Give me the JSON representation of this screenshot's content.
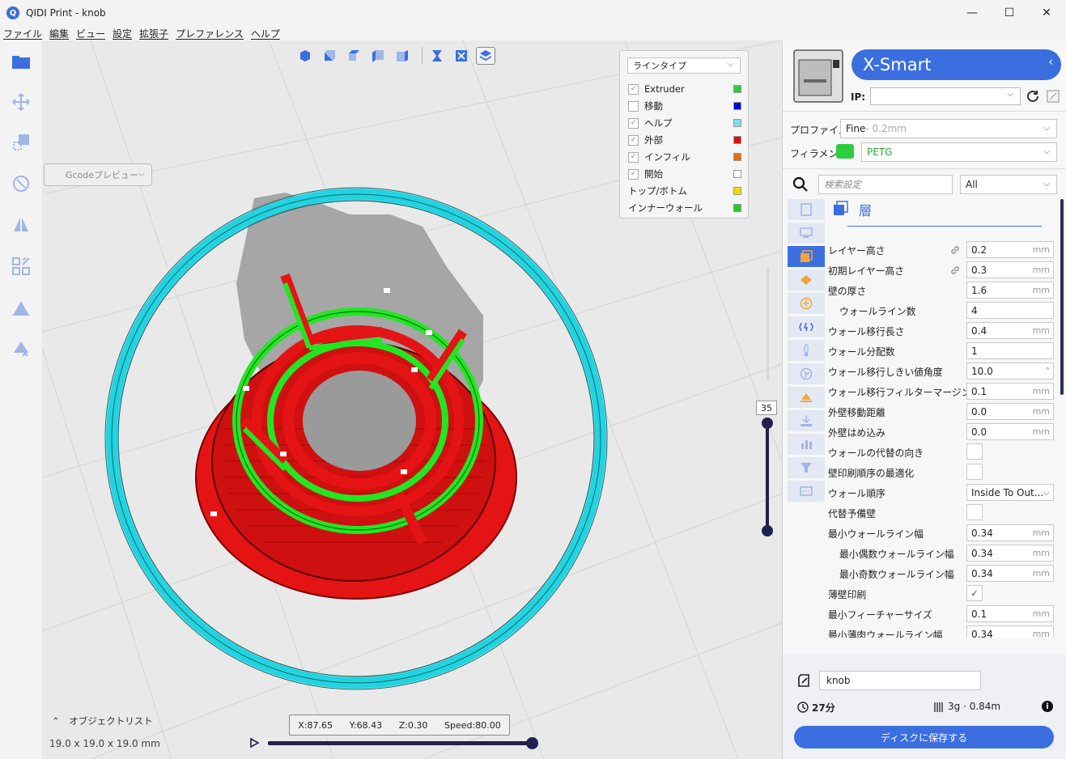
{
  "window": {
    "title": "QIDI Print - knob",
    "app_icon_letter": "Q",
    "minimize": "—",
    "maximize": "☐",
    "close": "✕"
  },
  "menu": [
    "ファイル",
    "編集",
    "ビュー",
    "設定",
    "拡張子",
    "プレファレンス",
    "ヘルプ"
  ],
  "viewport": {
    "gcode_select": "Gcodeプレビュー",
    "legend": {
      "select": "ラインタイプ",
      "items": [
        {
          "label": "Extruder",
          "checked": true,
          "color": "#2ecc40"
        },
        {
          "label": "移動",
          "checked": false,
          "color": "#0000dd"
        },
        {
          "label": "ヘルプ",
          "checked": true,
          "color": "#7fe0e8"
        },
        {
          "label": "外部",
          "checked": true,
          "color": "#dd1111"
        },
        {
          "label": "インフィル",
          "checked": true,
          "color": "#e07010"
        },
        {
          "label": "開始",
          "checked": true,
          "color": "#ffffff"
        },
        {
          "label": "トップ/ボトム",
          "checked": null,
          "color": "#eedd00"
        },
        {
          "label": "インナーウォール",
          "checked": null,
          "color": "#22cc22"
        }
      ]
    },
    "layer_value": "35",
    "position": {
      "x": "X:87.65",
      "y": "Y:68.43",
      "z": "Z:0.30",
      "speed": "Speed:80.00"
    },
    "object_list": "オブジェクトリスト",
    "dimensions": "19.0 x 19.0 x 19.0 mm",
    "progress": 1.0
  },
  "panel": {
    "printer_name": "X-Smart",
    "collapse_icon": "‹",
    "ip_label": "IP:",
    "ip_value": "",
    "profile_label": "プロファイル",
    "profile_value": "Fine",
    "profile_sub": " - 0.2mm",
    "filament_label": "フィラメント",
    "filament_value": "PETG",
    "search_placeholder": "検索設定",
    "filter_value": "All",
    "section_title": "層",
    "settings": [
      {
        "label": "レイヤー高さ",
        "value": "0.2",
        "unit": "mm",
        "link": true,
        "indent": 0
      },
      {
        "label": "初期レイヤー高さ",
        "value": "0.3",
        "unit": "mm",
        "link": true,
        "indent": 0
      },
      {
        "label": "壁の厚さ",
        "value": "1.6",
        "unit": "mm",
        "indent": 0
      },
      {
        "label": "ウォールライン数",
        "value": "4",
        "unit": "",
        "indent": 1
      },
      {
        "label": "ウォール移行長さ",
        "value": "0.4",
        "unit": "mm",
        "indent": 0
      },
      {
        "label": "ウォール分配数",
        "value": "1",
        "unit": "",
        "indent": 0
      },
      {
        "label": "ウォール移行しきい値角度",
        "value": "10.0",
        "unit": "°",
        "indent": 0
      },
      {
        "label": "ウォール移行フィルターマージン",
        "value": "0.1",
        "unit": "mm",
        "indent": 0
      },
      {
        "label": "外壁移動距離",
        "value": "0.0",
        "unit": "mm",
        "indent": 0
      },
      {
        "label": "外壁はめ込み",
        "value": "0.0",
        "unit": "mm",
        "indent": 0
      },
      {
        "label": "ウォールの代替の向き",
        "checkbox": false,
        "indent": 0
      },
      {
        "label": "壁印刷順序の最適化",
        "checkbox": false,
        "indent": 0
      },
      {
        "label": "ウォール順序",
        "value": "Inside To Out...",
        "dropdown": true,
        "indent": 0
      },
      {
        "label": "代替予備壁",
        "checkbox": false,
        "indent": 0
      },
      {
        "label": "最小ウォールライン幅",
        "value": "0.34",
        "unit": "mm",
        "indent": 0
      },
      {
        "label": "最小偶数ウォールライン幅",
        "value": "0.34",
        "unit": "mm",
        "indent": 1
      },
      {
        "label": "最小奇数ウォールライン幅",
        "value": "0.34",
        "unit": "mm",
        "indent": 1
      },
      {
        "label": "薄壁印刷",
        "checkbox": true,
        "indent": 0
      },
      {
        "label": "最小フィーチャーサイズ",
        "value": "0.1",
        "unit": "mm",
        "indent": 0
      },
      {
        "label": "最小薄肉ウォールライン幅",
        "value": "0.34",
        "unit": "mm",
        "indent": 0
      }
    ],
    "project_name": "knob",
    "print_time": "27分",
    "material_usage": "3g · 0.84m",
    "save_button": "ディスクに保存する"
  }
}
